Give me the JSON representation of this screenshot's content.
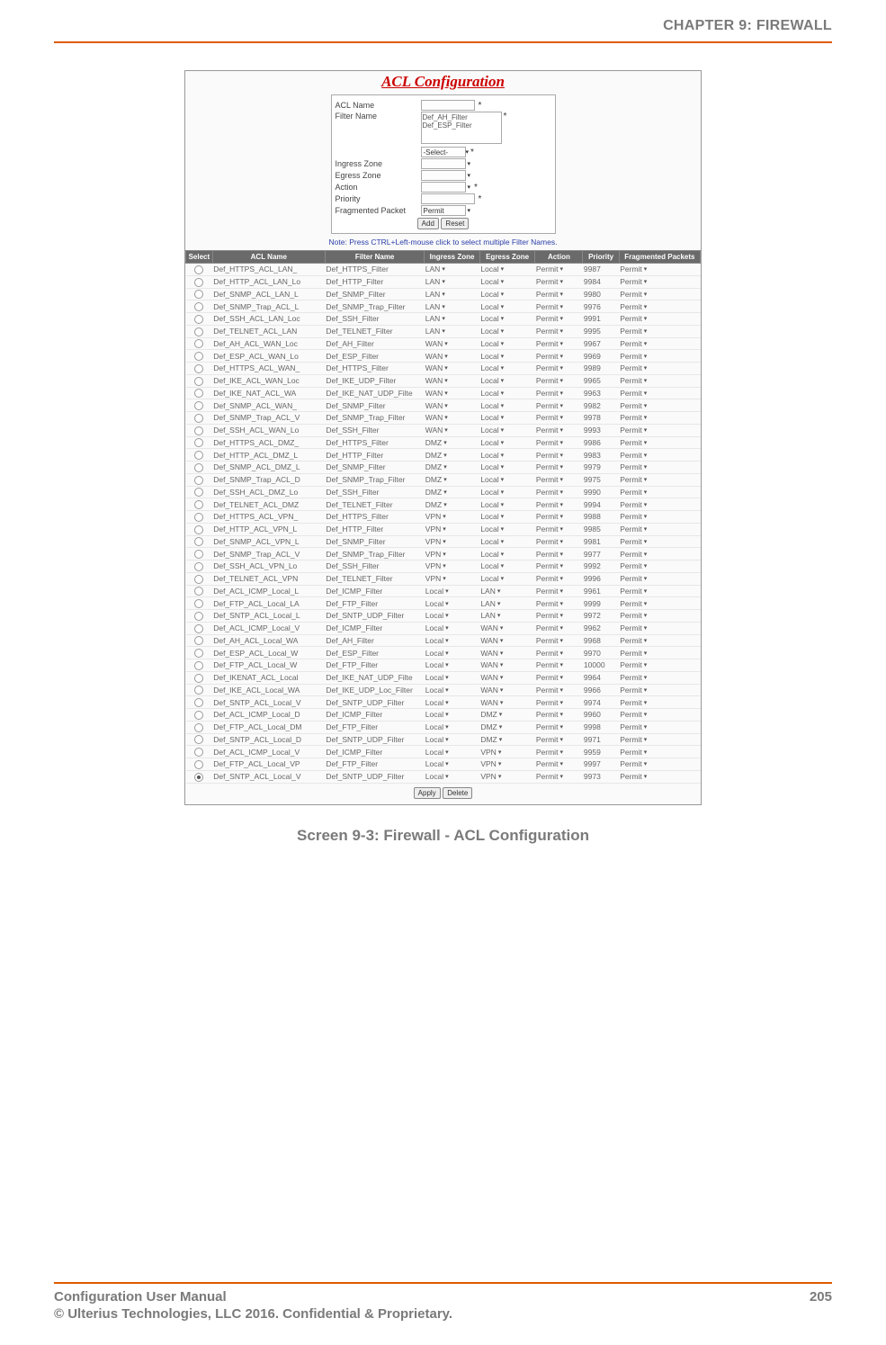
{
  "chapter_header": "CHAPTER 9: FIREWALL",
  "caption": "Screen 9-3: Firewall - ACL Configuration",
  "footer": {
    "left": "Configuration User Manual",
    "page": "205",
    "copyright": "© Ulterius Technologies, LLC 2016. Confidential & Proprietary."
  },
  "acl_title": "ACL Configuration",
  "form": {
    "acl_name_label": "ACL Name",
    "filter_name_label": "Filter Name",
    "filter_opt1": "Def_AH_Filter",
    "filter_opt2": "Def_ESP_Filter",
    "select_placeholder": "-Select-",
    "ingress_label": "Ingress Zone",
    "egress_label": "Egress Zone",
    "action_label": "Action",
    "priority_label": "Priority",
    "frag_label": "Fragmented Packet",
    "frag_value": "Permit",
    "add_btn": "Add",
    "reset_btn": "Reset"
  },
  "note": "Note: Press CTRL+Left-mouse click to select multiple Filter Names.",
  "headers": {
    "sel": "Select",
    "acl": "ACL Name",
    "filter": "Filter Name",
    "ing": "Ingress Zone",
    "eg": "Egress Zone",
    "act": "Action",
    "pri": "Priority",
    "frag": "Fragmented Packets"
  },
  "footer_btns": {
    "apply": "Apply",
    "delete": "Delete"
  },
  "rows": [
    {
      "sel": false,
      "acl": "Def_HTTPS_ACL_LAN_",
      "filter": "Def_HTTPS_Filter",
      "ing": "LAN",
      "eg": "Local",
      "act": "Permit",
      "pri": "9987",
      "frag": "Permit"
    },
    {
      "sel": false,
      "acl": "Def_HTTP_ACL_LAN_Lo",
      "filter": "Def_HTTP_Filter",
      "ing": "LAN",
      "eg": "Local",
      "act": "Permit",
      "pri": "9984",
      "frag": "Permit"
    },
    {
      "sel": false,
      "acl": "Def_SNMP_ACL_LAN_L",
      "filter": "Def_SNMP_Filter",
      "ing": "LAN",
      "eg": "Local",
      "act": "Permit",
      "pri": "9980",
      "frag": "Permit"
    },
    {
      "sel": false,
      "acl": "Def_SNMP_Trap_ACL_L",
      "filter": "Def_SNMP_Trap_Filter",
      "ing": "LAN",
      "eg": "Local",
      "act": "Permit",
      "pri": "9976",
      "frag": "Permit"
    },
    {
      "sel": false,
      "acl": "Def_SSH_ACL_LAN_Loc",
      "filter": "Def_SSH_Filter",
      "ing": "LAN",
      "eg": "Local",
      "act": "Permit",
      "pri": "9991",
      "frag": "Permit"
    },
    {
      "sel": false,
      "acl": "Def_TELNET_ACL_LAN",
      "filter": "Def_TELNET_Filter",
      "ing": "LAN",
      "eg": "Local",
      "act": "Permit",
      "pri": "9995",
      "frag": "Permit"
    },
    {
      "sel": false,
      "acl": "Def_AH_ACL_WAN_Loc",
      "filter": "Def_AH_Filter",
      "ing": "WAN",
      "eg": "Local",
      "act": "Permit",
      "pri": "9967",
      "frag": "Permit"
    },
    {
      "sel": false,
      "acl": "Def_ESP_ACL_WAN_Lo",
      "filter": "Def_ESP_Filter",
      "ing": "WAN",
      "eg": "Local",
      "act": "Permit",
      "pri": "9969",
      "frag": "Permit"
    },
    {
      "sel": false,
      "acl": "Def_HTTPS_ACL_WAN_",
      "filter": "Def_HTTPS_Filter",
      "ing": "WAN",
      "eg": "Local",
      "act": "Permit",
      "pri": "9989",
      "frag": "Permit"
    },
    {
      "sel": false,
      "acl": "Def_IKE_ACL_WAN_Loc",
      "filter": "Def_IKE_UDP_Filter",
      "ing": "WAN",
      "eg": "Local",
      "act": "Permit",
      "pri": "9965",
      "frag": "Permit"
    },
    {
      "sel": false,
      "acl": "Def_IKE_NAT_ACL_WA",
      "filter": "Def_IKE_NAT_UDP_Filte",
      "ing": "WAN",
      "eg": "Local",
      "act": "Permit",
      "pri": "9963",
      "frag": "Permit"
    },
    {
      "sel": false,
      "acl": "Def_SNMP_ACL_WAN_",
      "filter": "Def_SNMP_Filter",
      "ing": "WAN",
      "eg": "Local",
      "act": "Permit",
      "pri": "9982",
      "frag": "Permit"
    },
    {
      "sel": false,
      "acl": "Def_SNMP_Trap_ACL_V",
      "filter": "Def_SNMP_Trap_Filter",
      "ing": "WAN",
      "eg": "Local",
      "act": "Permit",
      "pri": "9978",
      "frag": "Permit"
    },
    {
      "sel": false,
      "acl": "Def_SSH_ACL_WAN_Lo",
      "filter": "Def_SSH_Filter",
      "ing": "WAN",
      "eg": "Local",
      "act": "Permit",
      "pri": "9993",
      "frag": "Permit"
    },
    {
      "sel": false,
      "acl": "Def_HTTPS_ACL_DMZ_",
      "filter": "Def_HTTPS_Filter",
      "ing": "DMZ",
      "eg": "Local",
      "act": "Permit",
      "pri": "9986",
      "frag": "Permit"
    },
    {
      "sel": false,
      "acl": "Def_HTTP_ACL_DMZ_L",
      "filter": "Def_HTTP_Filter",
      "ing": "DMZ",
      "eg": "Local",
      "act": "Permit",
      "pri": "9983",
      "frag": "Permit"
    },
    {
      "sel": false,
      "acl": "Def_SNMP_ACL_DMZ_L",
      "filter": "Def_SNMP_Filter",
      "ing": "DMZ",
      "eg": "Local",
      "act": "Permit",
      "pri": "9979",
      "frag": "Permit"
    },
    {
      "sel": false,
      "acl": "Def_SNMP_Trap_ACL_D",
      "filter": "Def_SNMP_Trap_Filter",
      "ing": "DMZ",
      "eg": "Local",
      "act": "Permit",
      "pri": "9975",
      "frag": "Permit"
    },
    {
      "sel": false,
      "acl": "Def_SSH_ACL_DMZ_Lo",
      "filter": "Def_SSH_Filter",
      "ing": "DMZ",
      "eg": "Local",
      "act": "Permit",
      "pri": "9990",
      "frag": "Permit"
    },
    {
      "sel": false,
      "acl": "Def_TELNET_ACL_DMZ",
      "filter": "Def_TELNET_Filter",
      "ing": "DMZ",
      "eg": "Local",
      "act": "Permit",
      "pri": "9994",
      "frag": "Permit"
    },
    {
      "sel": false,
      "acl": "Def_HTTPS_ACL_VPN_",
      "filter": "Def_HTTPS_Filter",
      "ing": "VPN",
      "eg": "Local",
      "act": "Permit",
      "pri": "9988",
      "frag": "Permit"
    },
    {
      "sel": false,
      "acl": "Def_HTTP_ACL_VPN_L",
      "filter": "Def_HTTP_Filter",
      "ing": "VPN",
      "eg": "Local",
      "act": "Permit",
      "pri": "9985",
      "frag": "Permit"
    },
    {
      "sel": false,
      "acl": "Def_SNMP_ACL_VPN_L",
      "filter": "Def_SNMP_Filter",
      "ing": "VPN",
      "eg": "Local",
      "act": "Permit",
      "pri": "9981",
      "frag": "Permit"
    },
    {
      "sel": false,
      "acl": "Def_SNMP_Trap_ACL_V",
      "filter": "Def_SNMP_Trap_Filter",
      "ing": "VPN",
      "eg": "Local",
      "act": "Permit",
      "pri": "9977",
      "frag": "Permit"
    },
    {
      "sel": false,
      "acl": "Def_SSH_ACL_VPN_Lo",
      "filter": "Def_SSH_Filter",
      "ing": "VPN",
      "eg": "Local",
      "act": "Permit",
      "pri": "9992",
      "frag": "Permit"
    },
    {
      "sel": false,
      "acl": "Def_TELNET_ACL_VPN",
      "filter": "Def_TELNET_Filter",
      "ing": "VPN",
      "eg": "Local",
      "act": "Permit",
      "pri": "9996",
      "frag": "Permit"
    },
    {
      "sel": false,
      "acl": "Def_ACL_ICMP_Local_L",
      "filter": "Def_ICMP_Filter",
      "ing": "Local",
      "eg": "LAN",
      "act": "Permit",
      "pri": "9961",
      "frag": "Permit"
    },
    {
      "sel": false,
      "acl": "Def_FTP_ACL_Local_LA",
      "filter": "Def_FTP_Filter",
      "ing": "Local",
      "eg": "LAN",
      "act": "Permit",
      "pri": "9999",
      "frag": "Permit"
    },
    {
      "sel": false,
      "acl": "Def_SNTP_ACL_Local_L",
      "filter": "Def_SNTP_UDP_Filter",
      "ing": "Local",
      "eg": "LAN",
      "act": "Permit",
      "pri": "9972",
      "frag": "Permit"
    },
    {
      "sel": false,
      "acl": "Def_ACL_ICMP_Local_V",
      "filter": "Def_ICMP_Filter",
      "ing": "Local",
      "eg": "WAN",
      "act": "Permit",
      "pri": "9962",
      "frag": "Permit"
    },
    {
      "sel": false,
      "acl": "Def_AH_ACL_Local_WA",
      "filter": "Def_AH_Filter",
      "ing": "Local",
      "eg": "WAN",
      "act": "Permit",
      "pri": "9968",
      "frag": "Permit"
    },
    {
      "sel": false,
      "acl": "Def_ESP_ACL_Local_W",
      "filter": "Def_ESP_Filter",
      "ing": "Local",
      "eg": "WAN",
      "act": "Permit",
      "pri": "9970",
      "frag": "Permit"
    },
    {
      "sel": false,
      "acl": "Def_FTP_ACL_Local_W",
      "filter": "Def_FTP_Filter",
      "ing": "Local",
      "eg": "WAN",
      "act": "Permit",
      "pri": "10000",
      "frag": "Permit"
    },
    {
      "sel": false,
      "acl": "Def_IKENAT_ACL_Local",
      "filter": "Def_IKE_NAT_UDP_Filte",
      "ing": "Local",
      "eg": "WAN",
      "act": "Permit",
      "pri": "9964",
      "frag": "Permit"
    },
    {
      "sel": false,
      "acl": "Def_IKE_ACL_Local_WA",
      "filter": "Def_IKE_UDP_Loc_Filter",
      "ing": "Local",
      "eg": "WAN",
      "act": "Permit",
      "pri": "9966",
      "frag": "Permit"
    },
    {
      "sel": false,
      "acl": "Def_SNTP_ACL_Local_V",
      "filter": "Def_SNTP_UDP_Filter",
      "ing": "Local",
      "eg": "WAN",
      "act": "Permit",
      "pri": "9974",
      "frag": "Permit"
    },
    {
      "sel": false,
      "acl": "Def_ACL_ICMP_Local_D",
      "filter": "Def_ICMP_Filter",
      "ing": "Local",
      "eg": "DMZ",
      "act": "Permit",
      "pri": "9960",
      "frag": "Permit"
    },
    {
      "sel": false,
      "acl": "Def_FTP_ACL_Local_DM",
      "filter": "Def_FTP_Filter",
      "ing": "Local",
      "eg": "DMZ",
      "act": "Permit",
      "pri": "9998",
      "frag": "Permit"
    },
    {
      "sel": false,
      "acl": "Def_SNTP_ACL_Local_D",
      "filter": "Def_SNTP_UDP_Filter",
      "ing": "Local",
      "eg": "DMZ",
      "act": "Permit",
      "pri": "9971",
      "frag": "Permit"
    },
    {
      "sel": false,
      "acl": "Def_ACL_ICMP_Local_V",
      "filter": "Def_ICMP_Filter",
      "ing": "Local",
      "eg": "VPN",
      "act": "Permit",
      "pri": "9959",
      "frag": "Permit"
    },
    {
      "sel": false,
      "acl": "Def_FTP_ACL_Local_VP",
      "filter": "Def_FTP_Filter",
      "ing": "Local",
      "eg": "VPN",
      "act": "Permit",
      "pri": "9997",
      "frag": "Permit"
    },
    {
      "sel": true,
      "acl": "Def_SNTP_ACL_Local_V",
      "filter": "Def_SNTP_UDP_Filter",
      "ing": "Local",
      "eg": "VPN",
      "act": "Permit",
      "pri": "9973",
      "frag": "Permit"
    }
  ]
}
